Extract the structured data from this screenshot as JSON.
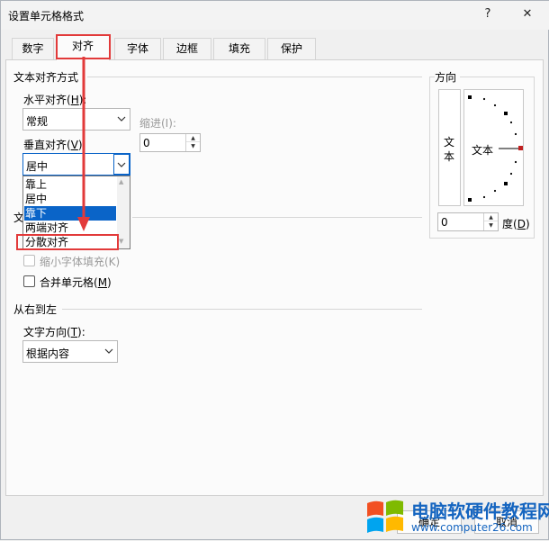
{
  "window": {
    "title": "设置单元格格式",
    "help_label": "?",
    "close_label": "✕"
  },
  "tabs": [
    {
      "label": "数字"
    },
    {
      "label": "对齐"
    },
    {
      "label": "字体"
    },
    {
      "label": "边框"
    },
    {
      "label": "填充"
    },
    {
      "label": "保护"
    }
  ],
  "active_tab": "对齐",
  "text_alignment": {
    "group_label": "文本对齐方式",
    "horizontal": {
      "label": "水平对齐(",
      "key": "H",
      "suffix": "):",
      "value": "常规"
    },
    "indent": {
      "label": "缩进(I):",
      "value": "0"
    },
    "vertical": {
      "label": "垂直对齐(",
      "key": "V",
      "suffix": "):",
      "value": "居中",
      "options": [
        "靠上",
        "居中",
        "靠下",
        "两端对齐",
        "分散对齐"
      ],
      "highlighted": "靠下"
    }
  },
  "text_control": {
    "group_label_partial": "文",
    "shrink": {
      "label": "缩小字体填充(K)",
      "enabled": false
    },
    "merge": {
      "label": "合并单元格(",
      "key": "M",
      "suffix": ")",
      "checked": false
    }
  },
  "rtl": {
    "group_label": "从右到左",
    "direction": {
      "label": "文字方向(",
      "key": "T",
      "suffix": "):",
      "value": "根据内容"
    }
  },
  "orientation": {
    "group_label": "方向",
    "vertical_text": "文\n本",
    "dial_text": "文本",
    "degrees": {
      "value": "0",
      "label": "度(",
      "key": "D",
      "suffix": ")"
    }
  },
  "footer": {
    "ok_label": "确定",
    "cancel_label": "取消"
  },
  "watermark": {
    "title": "电脑软硬件教程网",
    "url": "www.computer26.com"
  },
  "colors": {
    "accent": "#0a64c8",
    "annotation_red": "#e23a3a"
  }
}
